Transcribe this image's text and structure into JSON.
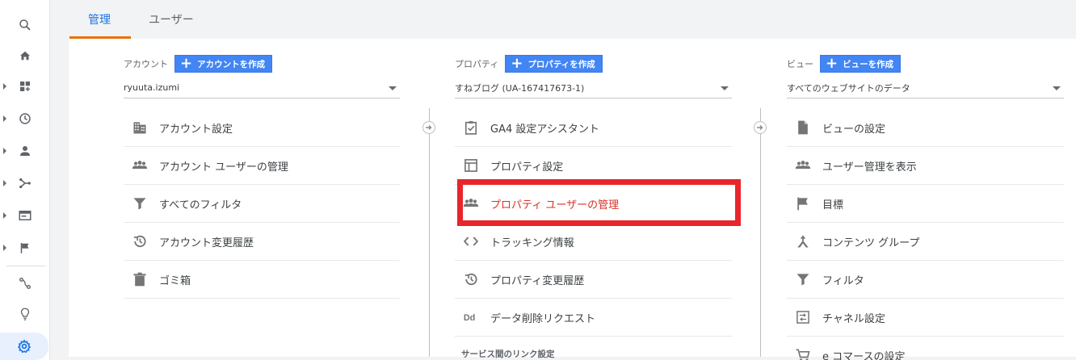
{
  "rail": {
    "items": [
      {
        "icon": "search-icon",
        "expandable": false
      },
      {
        "icon": "home-icon",
        "expandable": false
      },
      {
        "icon": "dashboard-icon",
        "expandable": true
      },
      {
        "icon": "clock-icon",
        "expandable": true
      },
      {
        "icon": "person-icon",
        "expandable": true
      },
      {
        "icon": "acquisition-icon",
        "expandable": true
      },
      {
        "icon": "behavior-icon",
        "expandable": true
      },
      {
        "icon": "flag-icon",
        "expandable": true
      },
      {
        "icon": "attribution-icon",
        "expandable": false
      },
      {
        "icon": "lightbulb-icon",
        "expandable": false
      },
      {
        "icon": "gear-icon",
        "expandable": false,
        "active": true
      }
    ]
  },
  "tabs": {
    "admin": "管理",
    "users": "ユーザー"
  },
  "account": {
    "title": "アカウント",
    "create_label": "アカウントを作成",
    "selected": "ryuuta.izumi",
    "items": {
      "settings": "アカウント設定",
      "user_mgmt": "アカウント ユーザーの管理",
      "filters": "すべてのフィルタ",
      "history": "アカウント変更履歴",
      "trash": "ゴミ箱"
    }
  },
  "property": {
    "title": "プロパティ",
    "create_label": "プロパティを作成",
    "selected": "すねブログ (UA-167417673-1)",
    "items": {
      "ga4": "GA4 設定アシスタント",
      "settings": "プロパティ設定",
      "user_mgmt": "プロパティ ユーザーの管理",
      "tracking": "トラッキング情報",
      "history": "プロパティ変更履歴",
      "deletion": "データ削除リクエスト"
    },
    "section_label": "サービス間のリンク設定"
  },
  "view": {
    "title": "ビュー",
    "create_label": "ビューを作成",
    "selected": "すべてのウェブサイトのデータ",
    "items": {
      "settings": "ビューの設定",
      "user_mgmt": "ユーザー管理を表示",
      "goals": "目標",
      "content_group": "コンテンツ グループ",
      "filters": "フィルタ",
      "channel": "チャネル設定",
      "ecommerce": "e コマースの設定"
    }
  },
  "colors": {
    "accent": "#1a73e8",
    "tab_underline": "#e8710a",
    "button": "#4285f4",
    "highlight": "#e8252b"
  }
}
